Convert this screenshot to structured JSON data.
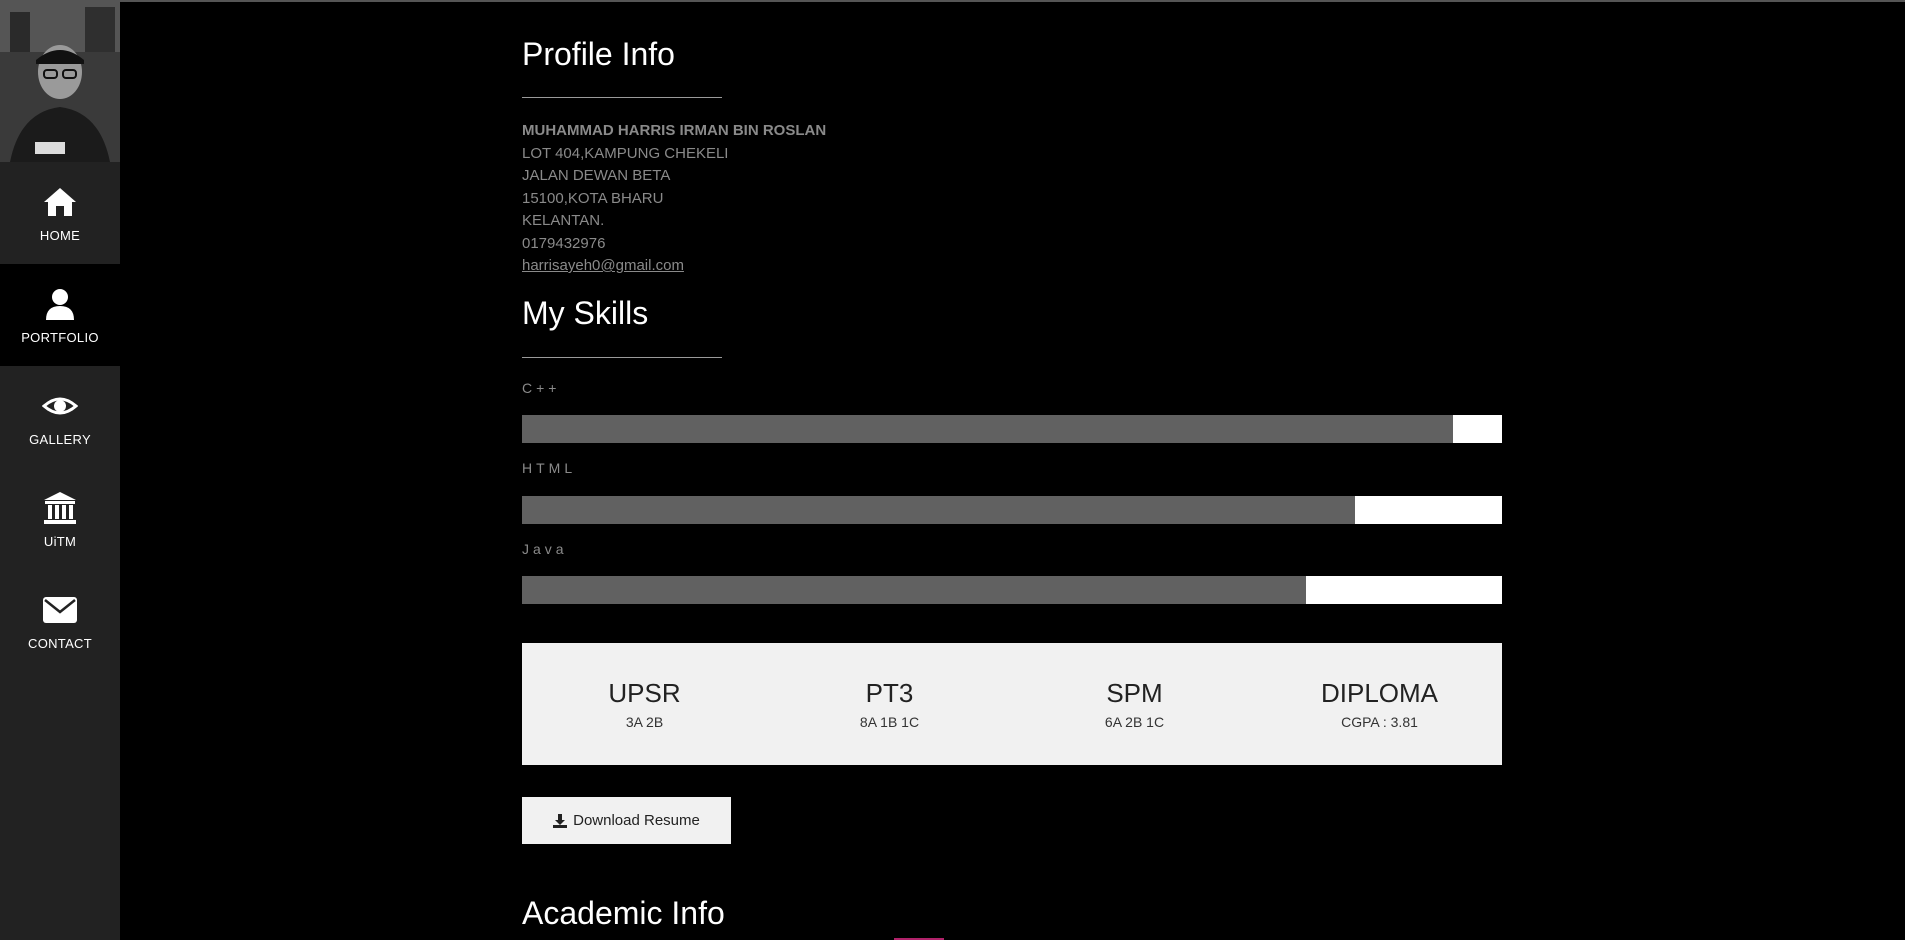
{
  "sidebar": {
    "items": [
      {
        "label": "HOME",
        "icon": "home-icon"
      },
      {
        "label": "PORTFOLIO",
        "icon": "user-icon"
      },
      {
        "label": "GALLERY",
        "icon": "eye-icon"
      },
      {
        "label": "UiTM",
        "icon": "institution-icon"
      },
      {
        "label": "CONTACT",
        "icon": "envelope-icon"
      }
    ],
    "active": "PORTFOLIO"
  },
  "profile": {
    "title": "Profile Info",
    "name": "MUHAMMAD HARRIS IRMAN BIN ROSLAN",
    "address_lines": [
      "LOT 404,KAMPUNG CHEKELI",
      "JALAN DEWAN BETA",
      "15100,KOTA BHARU",
      "KELANTAN."
    ],
    "phone": "0179432976",
    "email": "harrisayeh0@gmail.com"
  },
  "skills": {
    "title": "My Skills",
    "items": [
      {
        "label": "C++",
        "percent": 95
      },
      {
        "label": "HTML",
        "percent": 85
      },
      {
        "label": "Java",
        "percent": 80
      }
    ]
  },
  "grades": [
    {
      "title": "UPSR",
      "value": "3A 2B"
    },
    {
      "title": "PT3",
      "value": "8A 1B 1C"
    },
    {
      "title": "SPM",
      "value": "6A 2B 1C"
    },
    {
      "title": "DIPLOMA",
      "value": "CGPA : 3.81"
    }
  ],
  "download_label": "Download Resume",
  "academic_title": "Academic Info",
  "colors": {
    "sidebar_bg": "#222222",
    "page_bg": "#000000",
    "bar_fill": "#616161",
    "bar_track": "#ffffff",
    "grades_bg": "#f1f1f1"
  }
}
